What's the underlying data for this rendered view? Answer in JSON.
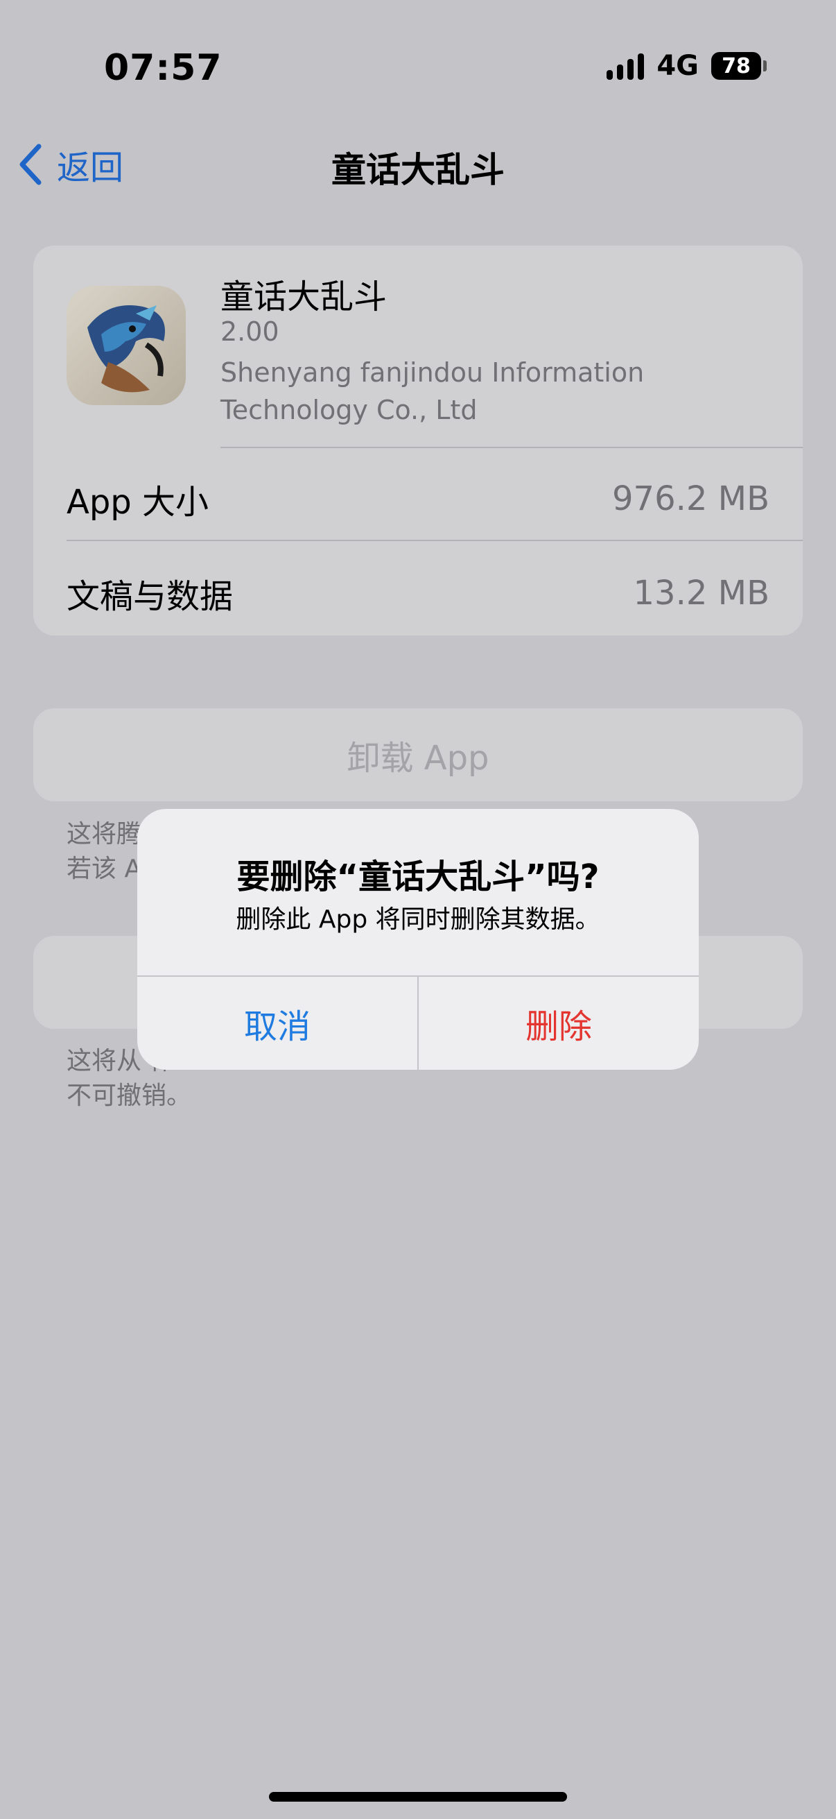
{
  "status_bar": {
    "time": "07:57",
    "network": "4G",
    "battery": "78"
  },
  "nav": {
    "back_label": "返回",
    "title": "童话大乱斗"
  },
  "app_info": {
    "name": "童话大乱斗",
    "version": "2.00",
    "developer": "Shenyang fanjindou Information Technology Co., Ltd",
    "rows": [
      {
        "label": "App 大小",
        "value": "976.2 MB"
      },
      {
        "label": "文稿与数据",
        "value": "13.2 MB"
      }
    ]
  },
  "offload": {
    "button_label": "卸载 App",
    "note_visible": "这将腾 据。\n若该 A"
  },
  "delete_section": {
    "note_visible": "这将从 作\n不可撤销。"
  },
  "alert": {
    "title": "要删除“童话大乱斗”吗?",
    "message": "删除此 App 将同时删除其数据。",
    "cancel_label": "取消",
    "delete_label": "删除"
  },
  "colors": {
    "accent": "#1f7be0",
    "destructive": "#e3342f",
    "background": "#c3c3c8"
  },
  "icons": [
    "chevron-left-icon",
    "signal-icon",
    "battery-icon",
    "app-icon"
  ]
}
